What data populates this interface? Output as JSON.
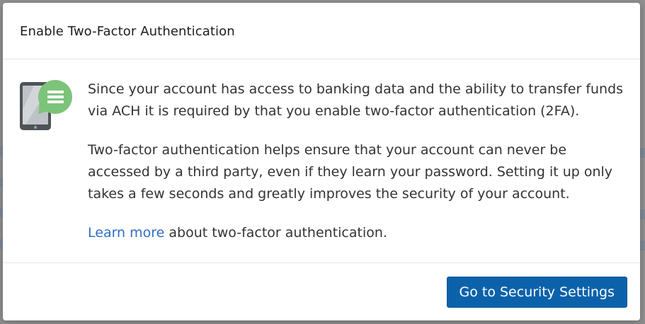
{
  "modal": {
    "title": "Enable Two-Factor Authentication",
    "paragraph_1": "Since your account has access to banking data and the ability to transfer funds via ACH it is required by that you enable two-factor authentication (2FA).",
    "paragraph_2": "Two-factor authentication helps ensure that your account can never be accessed by a third party, even if they learn your password. Setting it up only takes a few seconds and greatly improves the security of your account.",
    "learn_more_link": "Learn more",
    "learn_more_suffix": " about two-factor authentication.",
    "primary_button": "Go to Security Settings",
    "icon": "mobile-message-icon"
  },
  "colors": {
    "primary_button": "#0b62ab",
    "link": "#2f6fc4",
    "icon_badge": "#7cc47a",
    "device": "#4d5358"
  }
}
